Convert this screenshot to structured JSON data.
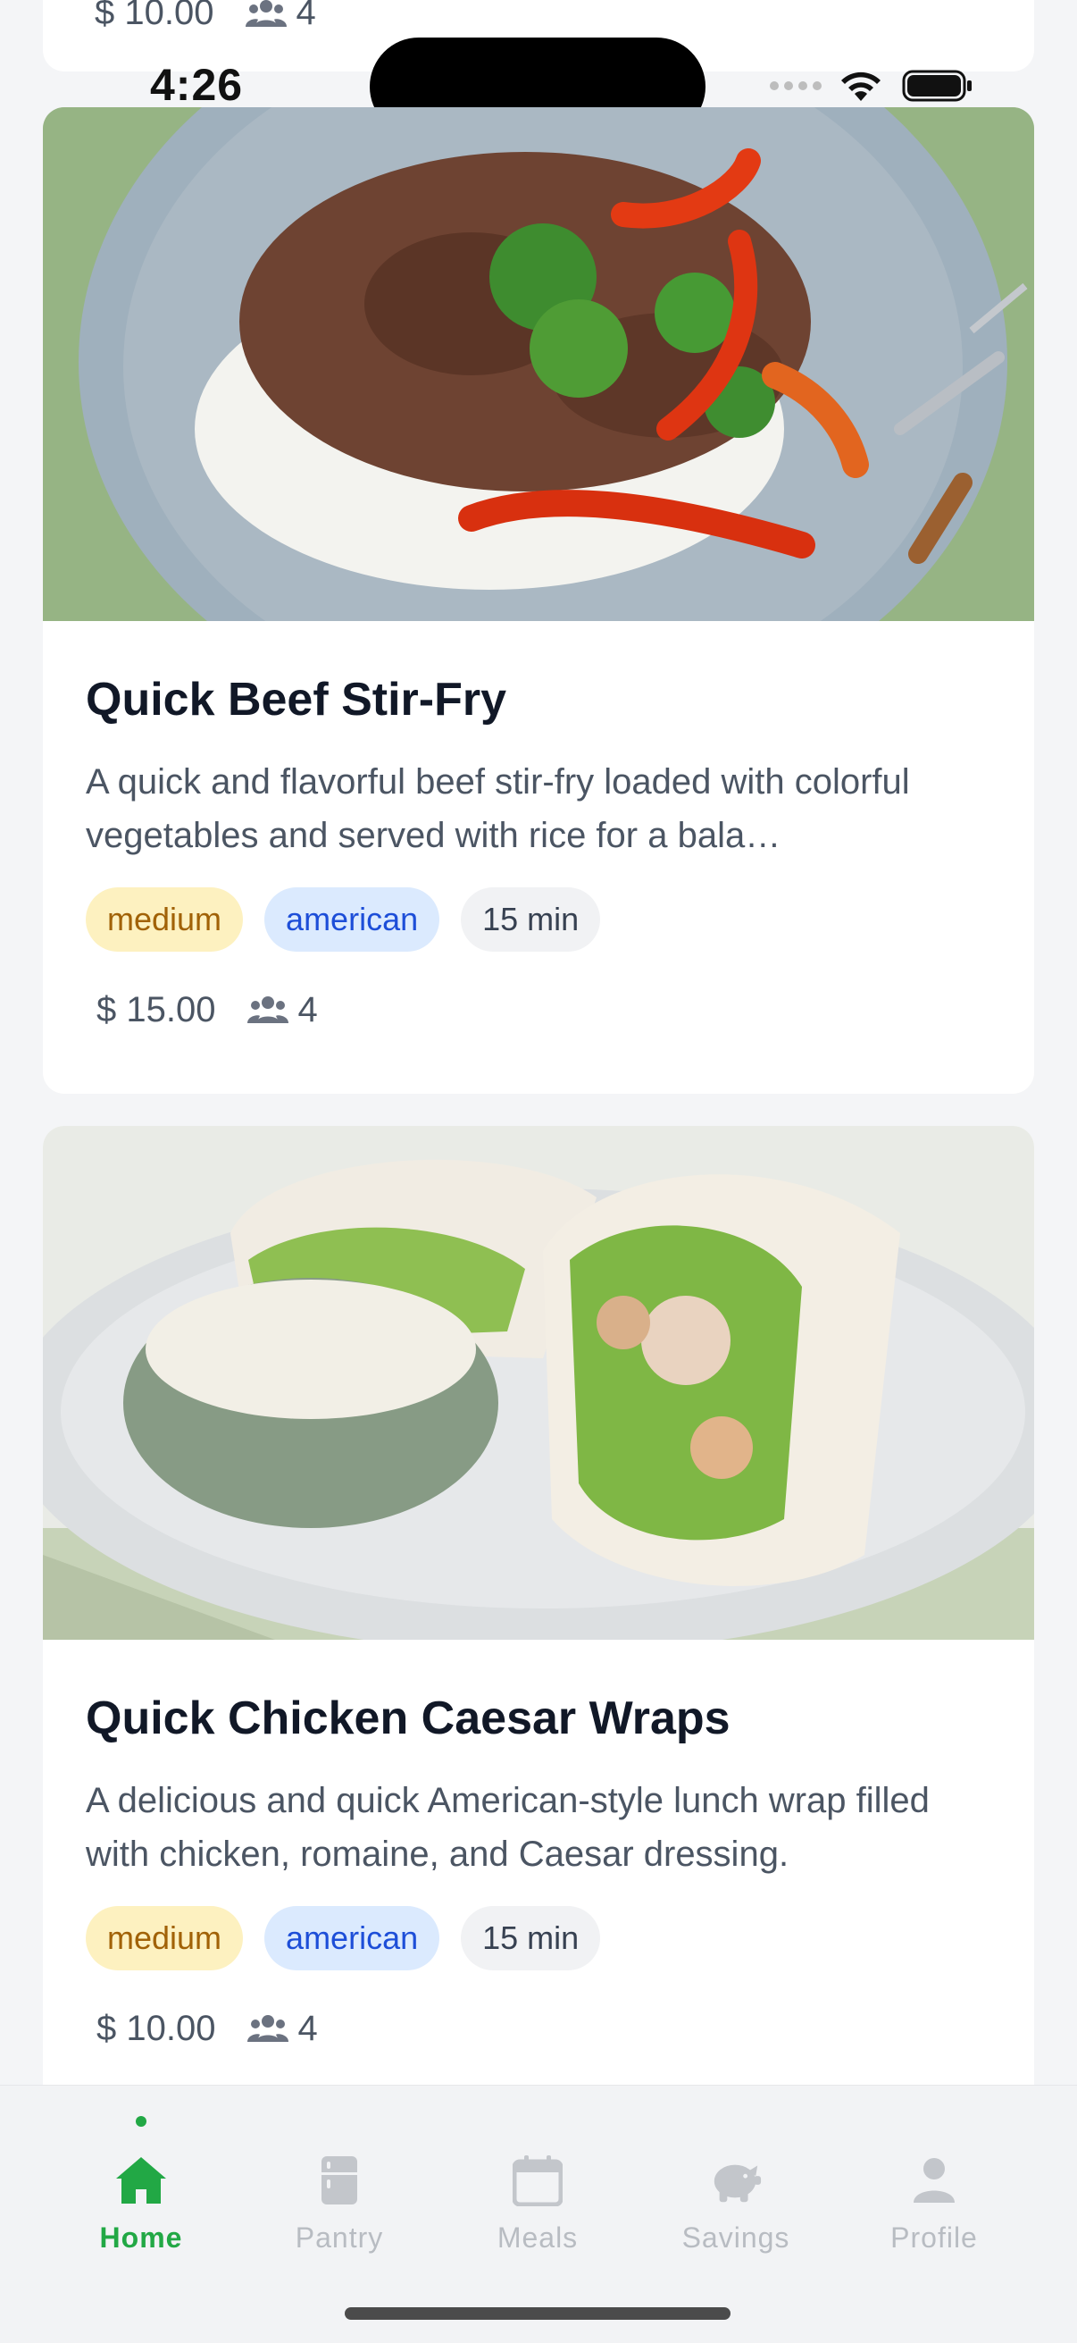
{
  "status_bar": {
    "time": "4:26"
  },
  "previous_card": {
    "price": "$ 10.00",
    "servings": "4"
  },
  "recipes": [
    {
      "title": "Quick Beef Stir-Fry",
      "description": "A quick and flavorful beef stir-fry loaded with colorful vegetables and served with rice for a bala…",
      "difficulty": "medium",
      "cuisine": "american",
      "time": "15 min",
      "price": "$ 15.00",
      "servings": "4"
    },
    {
      "title": "Quick Chicken Caesar Wraps",
      "description": "A delicious and quick American-style lunch wrap filled with chicken, romaine, and Caesar dressing.",
      "difficulty": "medium",
      "cuisine": "american",
      "time": "15 min",
      "price": "$ 10.00",
      "servings": "4"
    }
  ],
  "tabbar": {
    "active": "Home",
    "items": [
      {
        "label": "Home",
        "icon": "home-icon"
      },
      {
        "label": "Pantry",
        "icon": "fridge-icon"
      },
      {
        "label": "Meals",
        "icon": "calendar-icon"
      },
      {
        "label": "Savings",
        "icon": "piggy-bank-icon"
      },
      {
        "label": "Profile",
        "icon": "person-icon"
      }
    ]
  },
  "colors": {
    "accent": "#22a845",
    "tag_difficulty_bg": "#fdf1c0",
    "tag_cuisine_bg": "#dbeafe",
    "tag_time_bg": "#f1f2f4"
  }
}
